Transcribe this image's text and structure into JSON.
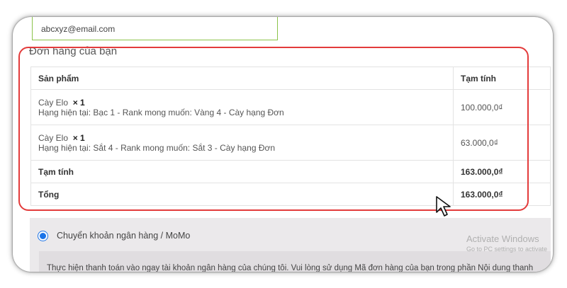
{
  "billing": {
    "email_value": "abcxyz@email.com"
  },
  "order": {
    "title": "Đơn hàng của bạn",
    "headers": {
      "product": "Sản phẩm",
      "subtotal": "Tạm tính"
    },
    "items": [
      {
        "name": "Cày Elo",
        "qty": "× 1",
        "detail": "Hạng hiện tại: Bạc 1 - Rank mong muốn: Vàng 4 - Cày hạng Đơn",
        "price": "100.000,0₫"
      },
      {
        "name": "Cày Elo",
        "qty": "× 1",
        "detail": "Hạng hiện tại: Sắt 4 - Rank mong muốn: Sắt 3 - Cày hạng Đơn",
        "price": "63.000,0₫"
      }
    ],
    "subtotal_label": "Tạm tính",
    "subtotal_value": "163.000,0₫",
    "total_label": "Tổng",
    "total_value": "163.000,0₫"
  },
  "payment": {
    "method_label": "Chuyển khoản ngân hàng / MoMo",
    "description": "Thực hiện thanh toán vào ngay tài khoản ngân hàng của chúng tôi. Vui lòng sử dụng Mã đơn hàng của bạn trong phần Nội dung thanh"
  },
  "watermark": {
    "line1": "Activate Windows",
    "line2": "Go to PC settings to activate"
  },
  "colors": {
    "highlight": "#e33b3b",
    "input_border": "#8bc34a",
    "radio": "#1a73e8"
  }
}
